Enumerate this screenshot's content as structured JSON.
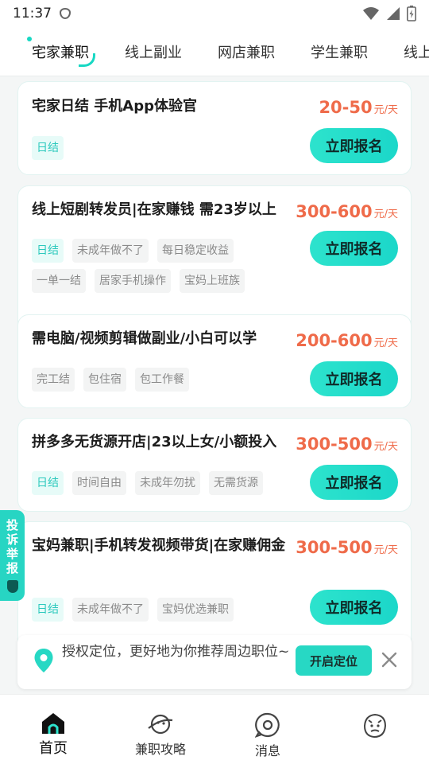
{
  "status_bar": {
    "time": "11:37"
  },
  "tabs": [
    {
      "label": "宅家兼职",
      "active": true
    },
    {
      "label": "线上副业",
      "active": false
    },
    {
      "label": "网店兼职",
      "active": false
    },
    {
      "label": "学生兼职",
      "active": false
    },
    {
      "label": "线上",
      "active": false
    }
  ],
  "jobs": [
    {
      "title": "宅家日结 手机App体验官",
      "salary": "20-50",
      "unit": "元/天",
      "apply_label": "立即报名",
      "tags": [
        {
          "text": "日结",
          "highlight": true
        }
      ]
    },
    {
      "title": "线上短剧转发员|在家赚钱 需23岁以上",
      "salary": "300-600",
      "unit": "元/天",
      "apply_label": "立即报名",
      "tags": [
        {
          "text": "日结",
          "highlight": true
        },
        {
          "text": "未成年做不了",
          "highlight": false
        },
        {
          "text": "每日稳定收益",
          "highlight": false
        },
        {
          "text": "一单一结",
          "highlight": false
        },
        {
          "text": "居家手机操作",
          "highlight": false
        },
        {
          "text": "宝妈上班族",
          "highlight": false
        }
      ]
    },
    {
      "title": "需电脑/视频剪辑做副业/小白可以学",
      "salary": "200-600",
      "unit": "元/天",
      "apply_label": "立即报名",
      "tags": [
        {
          "text": "完工结",
          "highlight": false
        },
        {
          "text": "包住宿",
          "highlight": false
        },
        {
          "text": "包工作餐",
          "highlight": false
        }
      ]
    },
    {
      "title": "拼多多无货源开店|23以上女/小额投入",
      "salary": "300-500",
      "unit": "元/天",
      "apply_label": "立即报名",
      "tags": [
        {
          "text": "日结",
          "highlight": true
        },
        {
          "text": "时间自由",
          "highlight": false
        },
        {
          "text": "未成年勿扰",
          "highlight": false
        },
        {
          "text": "无需货源",
          "highlight": false
        }
      ]
    },
    {
      "title": "宝妈兼职|手机转发视频带货|在家赚佣金",
      "salary": "300-500",
      "unit": "元/天",
      "apply_label": "立即报名",
      "tags": [
        {
          "text": "日结",
          "highlight": true
        },
        {
          "text": "未成年做不了",
          "highlight": false
        },
        {
          "text": "宝妈优选兼职",
          "highlight": false
        }
      ]
    }
  ],
  "side_report": {
    "chars": [
      "投",
      "诉",
      "举",
      "报"
    ]
  },
  "location_banner": {
    "text": "授权定位，更好地为你推荐周边职位~",
    "button": "开启定位"
  },
  "bottom_nav": [
    {
      "label": "首页",
      "icon": "home-icon",
      "active": true
    },
    {
      "label": "兼职攻略",
      "icon": "planet-icon",
      "active": false
    },
    {
      "label": "消息",
      "icon": "message-icon",
      "active": false
    },
    {
      "label": "",
      "icon": "avatar-doodle-icon",
      "active": false
    }
  ],
  "colors": {
    "accent": "#27d8c4",
    "salary": "#ef6b4a",
    "tag_highlight": "#2cc9bd"
  }
}
